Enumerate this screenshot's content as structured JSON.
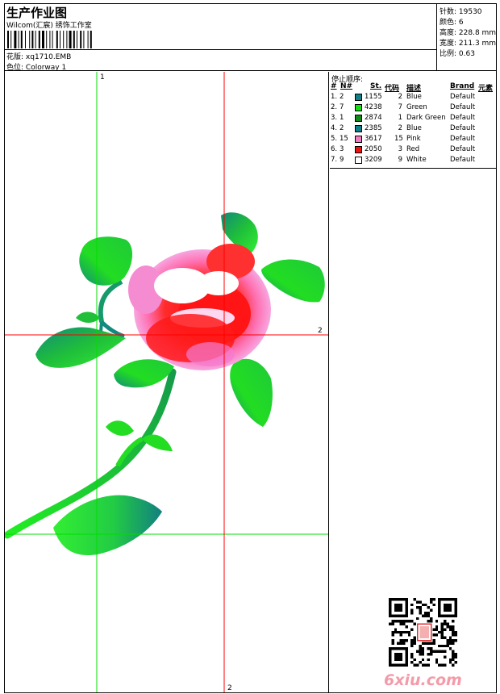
{
  "header": {
    "title": "生产作业图",
    "subtitle": "Wilcom(汇宸) 绣饰工作室",
    "pattern_label": "花版: ",
    "pattern_value": "xq1710.EMB",
    "colorway_label": "色位: ",
    "colorway_value": "Colorway 1"
  },
  "stats": [
    {
      "label": "针数: ",
      "value": "19530"
    },
    {
      "label": "颜色: ",
      "value": "6"
    },
    {
      "label": "高度: ",
      "value": "228.8 mm"
    },
    {
      "label": "宽度: ",
      "value": "211.3 mm"
    },
    {
      "label": "比例: ",
      "value": "0.63"
    }
  ],
  "guides": {
    "top_label": "1",
    "right_label": "2",
    "bottom_label": "2"
  },
  "stop_sequence": {
    "title": "停止顺序:",
    "columns": [
      "#",
      "N#",
      "St.",
      "代码",
      "描述",
      "Brand",
      "元素"
    ],
    "rows": [
      {
        "idx": "1.",
        "n": "2",
        "color": "#0e8087",
        "code": "1155",
        "st": "2",
        "desc": "Blue",
        "brand": "Default"
      },
      {
        "idx": "2.",
        "n": "7",
        "color": "#12e012",
        "code": "4238",
        "st": "7",
        "desc": "Green",
        "brand": "Default"
      },
      {
        "idx": "3.",
        "n": "1",
        "color": "#0f8a17",
        "code": "2874",
        "st": "1",
        "desc": "Dark Green",
        "brand": "Default"
      },
      {
        "idx": "4.",
        "n": "2",
        "color": "#0e8087",
        "code": "2385",
        "st": "2",
        "desc": "Blue",
        "brand": "Default"
      },
      {
        "idx": "5.",
        "n": "15",
        "color": "#f07cc0",
        "code": "3617",
        "st": "15",
        "desc": "Pink",
        "brand": "Default"
      },
      {
        "idx": "6.",
        "n": "3",
        "color": "#ee1111",
        "code": "2050",
        "st": "3",
        "desc": "Red",
        "brand": "Default"
      },
      {
        "idx": "7.",
        "n": "9",
        "color": "#ffffff",
        "code": "3209",
        "st": "9",
        "desc": "White",
        "brand": "Default"
      }
    ]
  },
  "watermark": {
    "logo_text": "6xiu.com"
  },
  "colors": {
    "guide_red": "#ff0000",
    "guide_green": "#00dd00",
    "leaf_green": "#22cc22",
    "leaf_teal": "#138a7e",
    "petal_red": "#ff1a1a",
    "petal_pink": "#f47ad0",
    "logo_pink": "#f49ba9"
  }
}
